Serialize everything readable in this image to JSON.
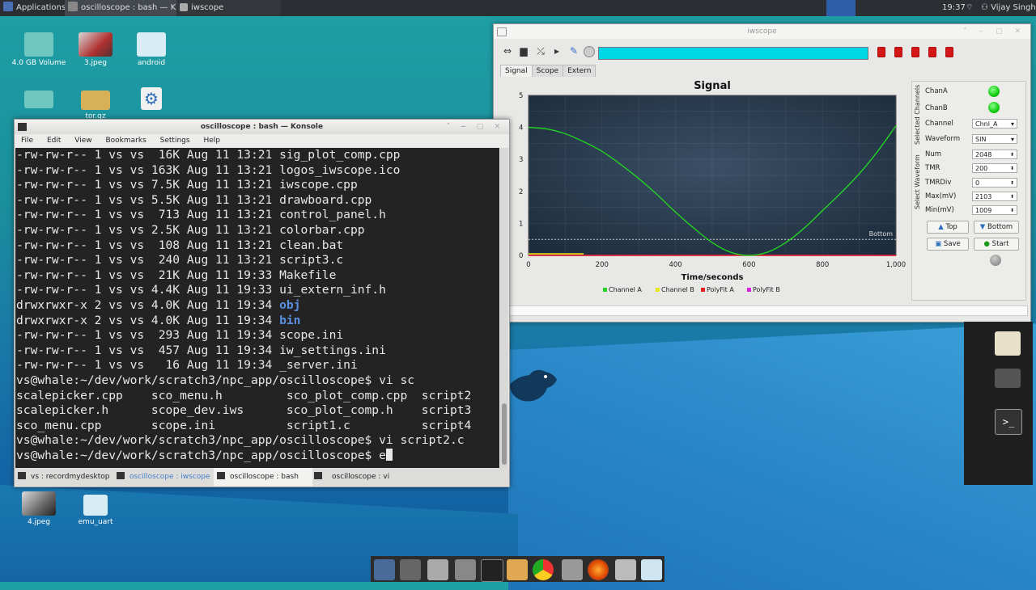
{
  "panel": {
    "applications": "Applications",
    "task_konsole": "oscilloscope : bash — K...",
    "task_iwscope": "iwscope",
    "clock": "19:37",
    "user": "Vijay Singh"
  },
  "desktop": {
    "icons": [
      {
        "label": "4.0 GB Volume"
      },
      {
        "label": "3.jpeg"
      },
      {
        "label": "android"
      },
      {
        "label": "tor.gz"
      },
      {
        "label": "4.jpeg"
      },
      {
        "label": "emu_uart"
      }
    ]
  },
  "konsole": {
    "title": "oscilloscope : bash — Konsole",
    "menu": [
      "File",
      "Edit",
      "View",
      "Bookmarks",
      "Settings",
      "Help"
    ],
    "lines": [
      {
        "text": "-rw-rw-r-- 1 vs vs  16K Aug 11 13:21 sig_plot_comp.cpp"
      },
      {
        "text": "-rw-rw-r-- 1 vs vs 163K Aug 11 13:21 logos_iwscope.ico"
      },
      {
        "text": "-rw-rw-r-- 1 vs vs 7.5K Aug 11 13:21 iwscope.cpp"
      },
      {
        "text": "-rw-rw-r-- 1 vs vs 5.5K Aug 11 13:21 drawboard.cpp"
      },
      {
        "text": "-rw-rw-r-- 1 vs vs  713 Aug 11 13:21 control_panel.h"
      },
      {
        "text": "-rw-rw-r-- 1 vs vs 2.5K Aug 11 13:21 colorbar.cpp"
      },
      {
        "text": "-rw-rw-r-- 1 vs vs  108 Aug 11 13:21 clean.bat"
      },
      {
        "text": "-rw-rw-r-- 1 vs vs  240 Aug 11 13:21 script3.c"
      },
      {
        "text": "-rw-rw-r-- 1 vs vs  21K Aug 11 19:33 Makefile"
      },
      {
        "text": "-rw-rw-r-- 1 vs vs 4.4K Aug 11 19:33 ui_extern_inf.h"
      },
      {
        "text": "drwxrwxr-x 2 vs vs 4.0K Aug 11 19:34 ",
        "dir": "obj"
      },
      {
        "text": "drwxrwxr-x 2 vs vs 4.0K Aug 11 19:34 ",
        "dir": "bin"
      },
      {
        "text": "-rw-rw-r-- 1 vs vs  293 Aug 11 19:34 scope.ini"
      },
      {
        "text": "-rw-rw-r-- 1 vs vs  457 Aug 11 19:34 iw_settings.ini"
      },
      {
        "text": "-rw-rw-r-- 1 vs vs   16 Aug 11 19:34 _server.ini"
      },
      {
        "text": "vs@whale:~/dev/work/scratch3/npc_app/oscilloscope$ vi sc"
      },
      {
        "text": "scalepicker.cpp    sco_menu.h         sco_plot_comp.cpp  script2"
      },
      {
        "text": "scalepicker.h      scope_dev.iws      sco_plot_comp.h    script3"
      },
      {
        "text": "sco_menu.cpp       scope.ini          script1.c          script4"
      },
      {
        "text": "vs@whale:~/dev/work/scratch3/npc_app/oscilloscope$ vi script2.c"
      },
      {
        "text": "vs@whale:~/dev/work/scratch3/npc_app/oscilloscope$ e"
      }
    ],
    "tabs": [
      {
        "label": "vs : recordmydesktop"
      },
      {
        "label": "oscilloscope : iwscope"
      },
      {
        "label": "oscilloscope : bash"
      },
      {
        "label": "oscilloscope : vi"
      }
    ]
  },
  "iwscope": {
    "title": "iwscope",
    "tabs": [
      "Signal",
      "Scope",
      "Extern"
    ],
    "side": {
      "selected_channels_label": "Selected Channels",
      "select_waveform_label": "Select Waveform",
      "chanA": "ChanA",
      "chanB": "ChanB",
      "channel_label": "Channel",
      "channel_value": "Chnl_A",
      "waveform_label": "Waveform",
      "waveform_value": "SIN",
      "num_label": "Num",
      "num_value": "2048",
      "tmr_label": "TMR",
      "tmr_value": "200",
      "tmrdiv_label": "TMRDiv",
      "tmrdiv_value": "0",
      "max_label": "Max(mV)",
      "max_value": "2103",
      "min_label": "Min(mV)",
      "min_value": "1009",
      "top_btn": "Top",
      "bottom_btn": "Bottom",
      "save_btn": "Save",
      "start_btn": "Start"
    }
  },
  "chart_data": {
    "type": "line",
    "title": "Signal",
    "xlabel": "Time/seconds",
    "ylabel": "",
    "xlim": [
      0,
      1000
    ],
    "ylim": [
      0,
      5
    ],
    "xticks": [
      "0",
      "200",
      "400",
      "600",
      "800",
      "1,000"
    ],
    "yticks": [
      "0",
      "1",
      "2",
      "3",
      "4",
      "5"
    ],
    "marker_label": "Bottom",
    "marker_y": 0.5,
    "series": [
      {
        "name": "Channel A",
        "color": "#22d322",
        "x": [
          0,
          50,
          100,
          150,
          200,
          250,
          300,
          350,
          400,
          450,
          500,
          550,
          600,
          650,
          700,
          750,
          800,
          850,
          900,
          950,
          1000
        ],
        "y": [
          4.0,
          3.95,
          3.8,
          3.55,
          3.25,
          2.85,
          2.4,
          1.9,
          1.35,
          0.85,
          0.4,
          0.1,
          0.0,
          0.1,
          0.4,
          0.85,
          1.4,
          1.95,
          2.55,
          3.25,
          4.05
        ]
      },
      {
        "name": "Channel B",
        "color": "#e8e820",
        "x": [
          0,
          150
        ],
        "y": [
          0.05,
          0.05
        ]
      },
      {
        "name": "PolyFit A",
        "color": "#e02020",
        "x": [
          0,
          1000
        ],
        "y": [
          0.0,
          0.0
        ]
      },
      {
        "name": "PolyFit B",
        "color": "#e020e0",
        "x": [
          0,
          1000
        ],
        "y": [
          0.0,
          0.0
        ]
      }
    ],
    "legend": "bottom"
  }
}
